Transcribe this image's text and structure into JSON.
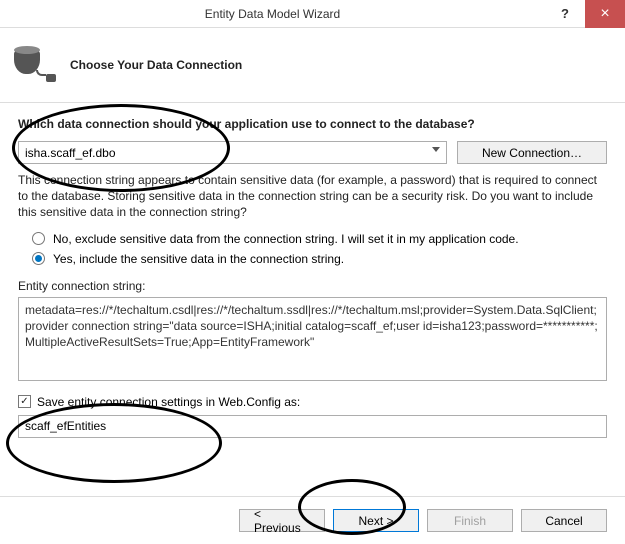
{
  "titlebar": {
    "title": "Entity Data Model Wizard",
    "help": "?",
    "close": "×"
  },
  "header": {
    "heading": "Choose Your Data Connection"
  },
  "content": {
    "question": "Which data connection should your application use to connect to the database?",
    "connection_value": "isha.scaff_ef.dbo",
    "new_connection_label": "New Connection…",
    "sensitive_info": "This connection string appears to contain sensitive data (for example, a password) that is required to connect to the database. Storing sensitive data in the connection string can be a security risk. Do you want to include this sensitive data in the connection string?",
    "radio": {
      "exclude": "No, exclude sensitive data from the connection string. I will set it in my application code.",
      "include": "Yes, include the sensitive data in the connection string."
    },
    "conn_label": "Entity connection string:",
    "conn_string": "metadata=res://*/techaltum.csdl|res://*/techaltum.ssdl|res://*/techaltum.msl;provider=System.Data.SqlClient;provider connection string=\"data source=ISHA;initial catalog=scaff_ef;user id=isha123;password=***********;MultipleActiveResultSets=True;App=EntityFramework\"",
    "save_checkbox_label": "Save entity connection settings in Web.Config as:",
    "save_name": "scaff_efEntities"
  },
  "footer": {
    "previous": "< Previous",
    "next": "Next >",
    "finish": "Finish",
    "cancel": "Cancel"
  }
}
